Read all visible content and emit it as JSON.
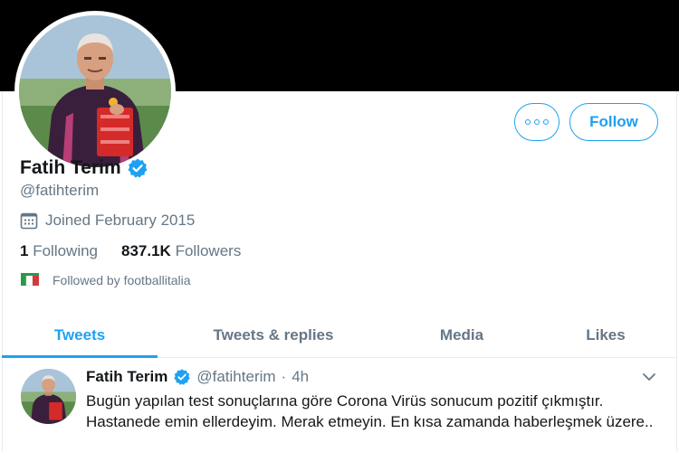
{
  "profile": {
    "display_name": "Fatih Terim",
    "handle": "@fatihterim",
    "joined": "Joined February 2015",
    "following_count": "1",
    "following_label": "Following",
    "followers_count": "837.1K",
    "followers_label": "Followers",
    "followed_by": "Followed by footballitalia"
  },
  "actions": {
    "follow_label": "Follow"
  },
  "tabs": [
    {
      "label": "Tweets",
      "active": true
    },
    {
      "label": "Tweets & replies",
      "active": false
    },
    {
      "label": "Media",
      "active": false
    },
    {
      "label": "Likes",
      "active": false
    }
  ],
  "tweet": {
    "name": "Fatih Terim",
    "handle": "@fatihterim",
    "separator": "·",
    "time": "4h",
    "text": "Bugün yapılan test sonuçlarına göre Corona Virüs sonucum pozitif çıkmıştır. Hastanede emin ellerdeyim. Merak etmeyin. En kısa zamanda haberleşmek üzere.."
  },
  "colors": {
    "accent": "#1da1f2",
    "banner": "#000000",
    "secondary_text": "#657786",
    "primary_text": "#14171a"
  },
  "icons": {
    "verified": "verified-badge-icon",
    "calendar": "calendar-icon",
    "more": "more-dots-icon",
    "chevron": "chevron-down-icon"
  }
}
